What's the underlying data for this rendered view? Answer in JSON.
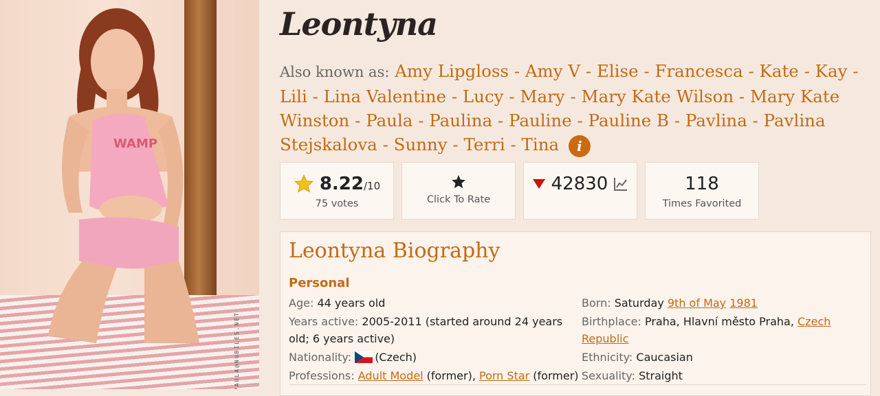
{
  "profile": {
    "name": "Leontyna",
    "aka_label": "Also known as:",
    "aliases": [
      "Amy Lipgloss",
      "Amy V",
      "Elise",
      "Francesca",
      "Kate",
      "Kay",
      "Lili",
      "Lina Valentine",
      "Lucy",
      "Mary",
      "Mary Kate Wilson",
      "Mary Kate Winston",
      "Paula",
      "Paulina",
      "Pauline",
      "Pauline B",
      "Pavlina",
      "Pavlina Stejskalova",
      "Sunny",
      "Terri",
      "Tina"
    ],
    "info_icon": "info-icon",
    "photo_watermark": "PAULA@NUBILES.NET"
  },
  "stats": {
    "rating_value": "8.22",
    "rating_scale": "/10",
    "rating_votes": "75 votes",
    "rate_icon": "star-icon",
    "rate_label": "Click To Rate",
    "rank_value": "42830",
    "rank_trend": "down",
    "favorites_value": "118",
    "favorites_label": "Times Favorited"
  },
  "biography": {
    "title": "Leontyna Biography",
    "section": "Personal",
    "left": {
      "age_key": "Age:",
      "age_val": "44 years old",
      "active_key": "Years active:",
      "active_val": "2005-2011 (started around 24 years old; 6 years active)",
      "nationality_key": "Nationality:",
      "nationality_val": "(Czech)",
      "professions_key": "Professions:",
      "prof1": "Adult Model",
      "prof1_note": " (former), ",
      "prof2": "Porn Star",
      "prof2_note": " (former)"
    },
    "right": {
      "born_key": "Born:",
      "born_day": "Saturday ",
      "born_date": "9th of May",
      "born_year": "1981",
      "birthplace_key": "Birthplace:",
      "birthplace_val": "Praha, Hlavní město Praha, ",
      "birthplace_country": "Czech Republic",
      "ethnicity_key": "Ethnicity:",
      "ethnicity_val": "Caucasian",
      "sexuality_key": "Sexuality:",
      "sexuality_val": "Straight"
    }
  },
  "colors": {
    "accent": "#c46a12",
    "background": "#f5e9df",
    "card": "#fdf7f2"
  }
}
